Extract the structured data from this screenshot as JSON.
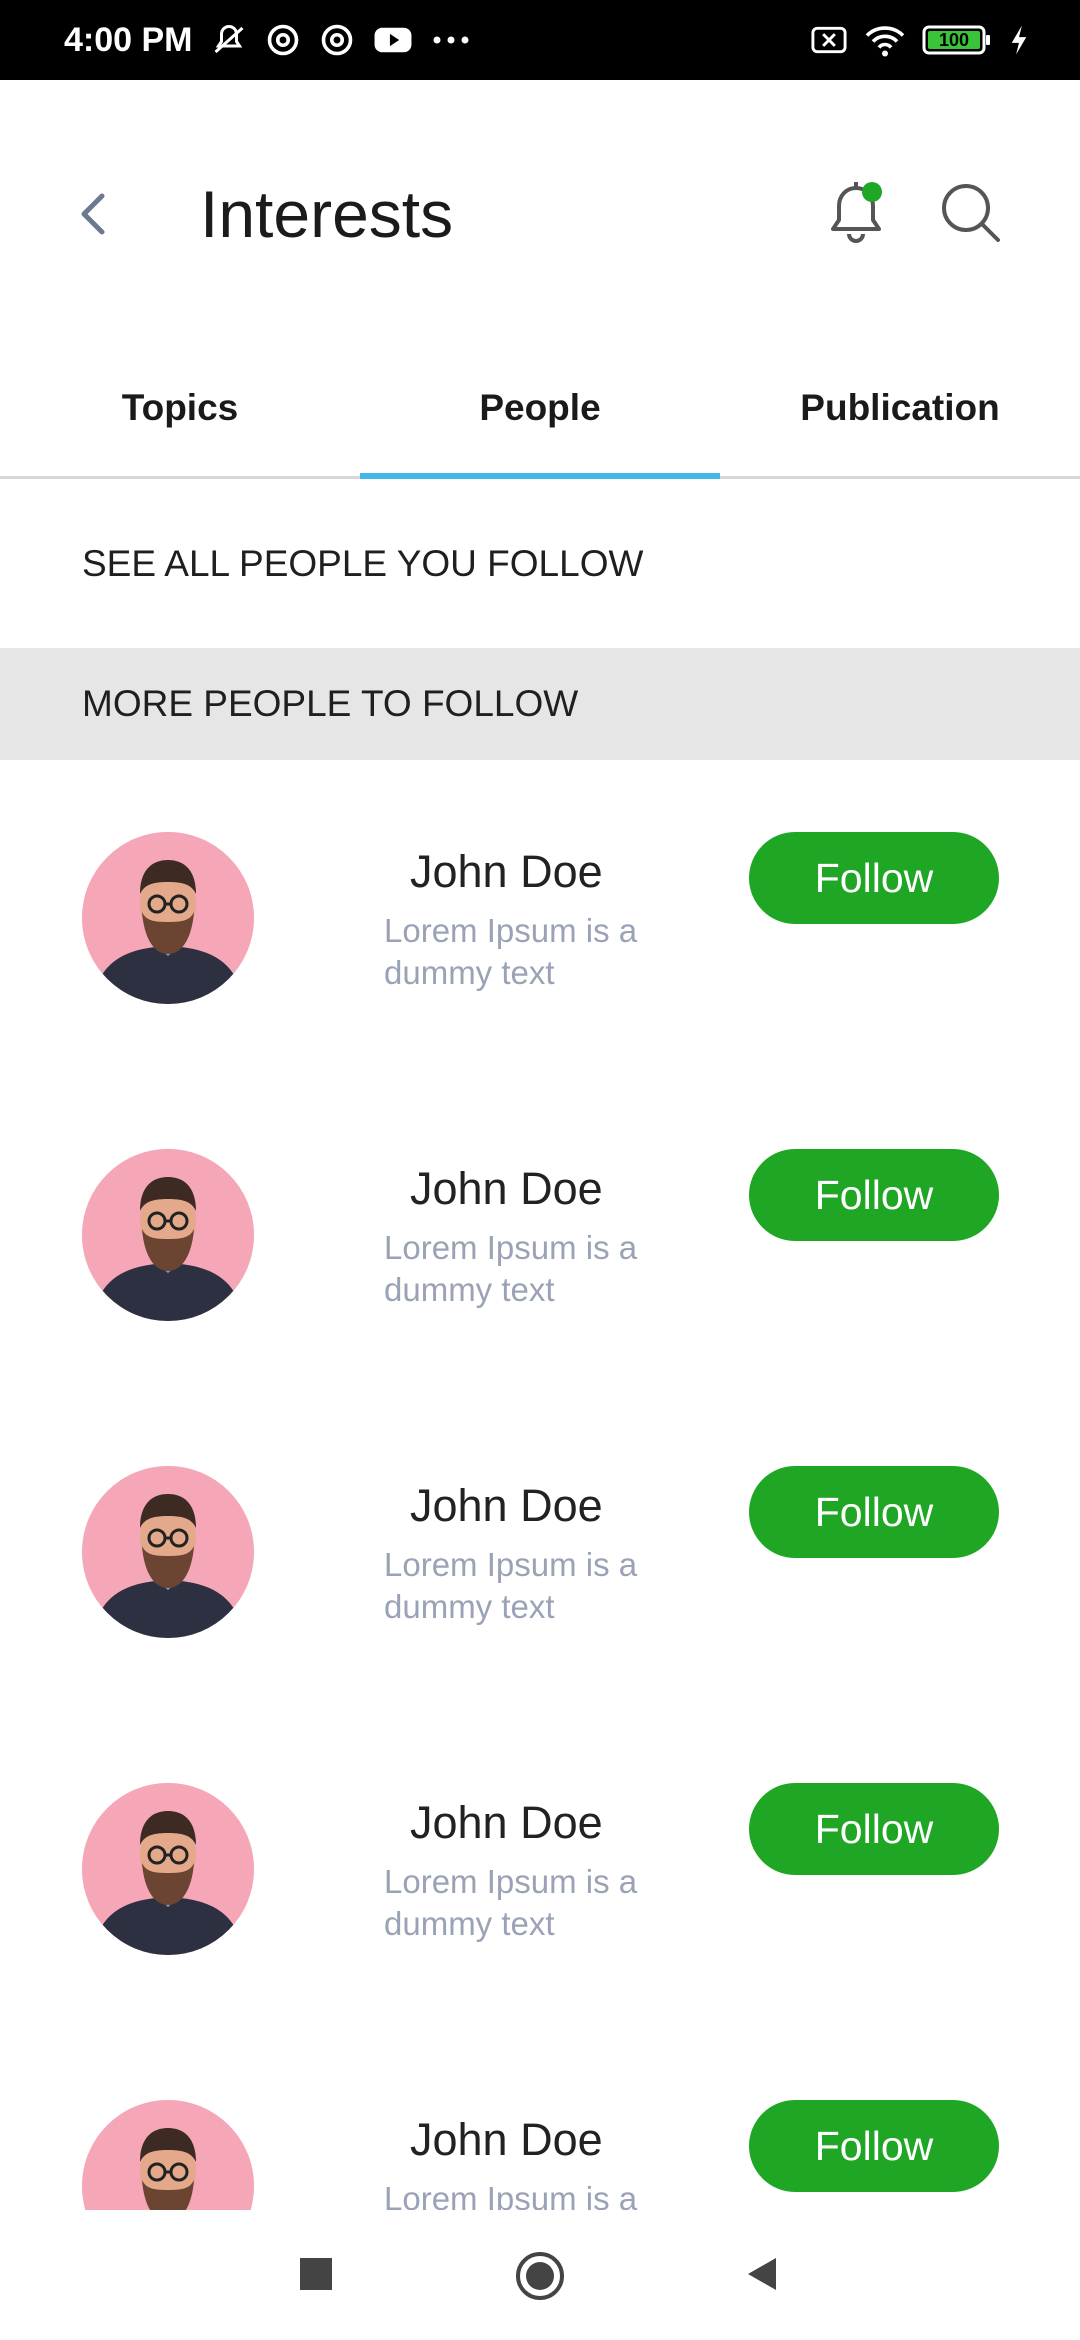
{
  "status_bar": {
    "time": "4:00 PM",
    "battery": "100",
    "icons": [
      "mute-bell-icon",
      "at-sign-icon",
      "at-sign-icon",
      "youtube-icon",
      "more-dots-icon",
      "sim-off-icon",
      "wifi-icon",
      "battery-icon",
      "charging-icon"
    ]
  },
  "header": {
    "title": "Interests",
    "notification_dot_color": "#1fa624"
  },
  "tabs": [
    {
      "label": "Topics"
    },
    {
      "label": "People"
    },
    {
      "label": "Publication"
    }
  ],
  "active_tab": "People",
  "accent_color": "#43b6ea",
  "sections": {
    "see_all": "SEE ALL PEOPLE YOU FOLLOW",
    "more_to_follow": "MORE PEOPLE TO FOLLOW"
  },
  "people": [
    {
      "name": "John Doe",
      "subtitle": "Lorem Ipsum is a dummy text",
      "button": "Follow"
    },
    {
      "name": "John Doe",
      "subtitle": "Lorem Ipsum is a dummy text",
      "button": "Follow"
    },
    {
      "name": "John Doe",
      "subtitle": "Lorem Ipsum is a dummy text",
      "button": "Follow"
    },
    {
      "name": "John Doe",
      "subtitle": "Lorem Ipsum is a dummy text",
      "button": "Follow"
    },
    {
      "name": "John Doe",
      "subtitle": "Lorem Ipsum is a dummy text",
      "button": "Follow"
    }
  ],
  "follow_button_color": "#1fa624"
}
